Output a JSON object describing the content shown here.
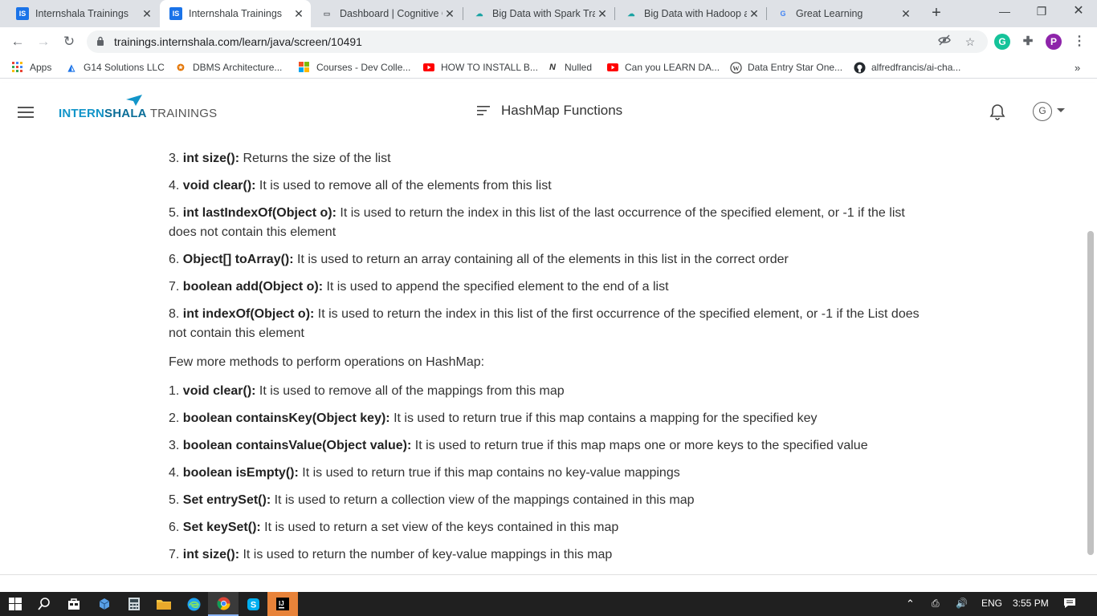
{
  "browser": {
    "tabs": [
      {
        "title": "Internshala Trainings",
        "icon": "internshala-favicon",
        "active": false
      },
      {
        "title": "Internshala Trainings",
        "icon": "internshala-favicon",
        "active": true
      },
      {
        "title": "Dashboard | Cognitive C",
        "icon": "dashboard-favicon",
        "active": false
      },
      {
        "title": "Big Data with Spark Tra",
        "icon": "cloud-favicon",
        "active": false
      },
      {
        "title": "Big Data with Hadoop a",
        "icon": "cloud-favicon",
        "active": false
      },
      {
        "title": "Great Learning",
        "icon": "google-favicon",
        "active": false
      }
    ],
    "url": "trainings.internshala.com/learn/java/screen/10491",
    "profile_initial": "P",
    "bookmarks": [
      {
        "label": "Apps",
        "icon": "apps-grid-icon"
      },
      {
        "label": "G14 Solutions LLC",
        "icon": "g14-icon"
      },
      {
        "label": "DBMS Architecture...",
        "icon": "dbms-icon"
      },
      {
        "label": "Courses - Dev Colle...",
        "icon": "windows-icon"
      },
      {
        "label": "HOW TO INSTALL B...",
        "icon": "youtube-icon"
      },
      {
        "label": "Nulled",
        "icon": "nulled-icon"
      },
      {
        "label": "Can you LEARN DA...",
        "icon": "youtube-icon"
      },
      {
        "label": "Data Entry Star One...",
        "icon": "wordpress-icon"
      },
      {
        "label": "alfredfrancis/ai-cha...",
        "icon": "github-icon"
      }
    ],
    "more_bookmarks": "»"
  },
  "header": {
    "logo_brand_part1": "INTERN",
    "logo_brand_part2": "SHALA",
    "logo_suffix": " TRAININGS",
    "page_title": "HashMap Functions",
    "user_initial": "G"
  },
  "content": {
    "list_items": [
      {
        "num": "3.",
        "sig": "int size():",
        "desc": " Returns the size of the list"
      },
      {
        "num": "4.",
        "sig": "void clear():",
        "desc": " It is used to remove all of the elements from this list"
      },
      {
        "num": "5.",
        "sig": "int lastIndexOf(Object o):",
        "desc": " It is used to return the index in this list of the last occurrence of the specified element, or -1 if the list does not contain this element"
      },
      {
        "num": "6.",
        "sig": "Object[] toArray():",
        "desc": " It is used to return an array containing all of the elements in this list in the correct order"
      },
      {
        "num": "7.",
        "sig": "boolean add(Object o):",
        "desc": " It is used to append the specified element to the end of a list"
      },
      {
        "num": "8.",
        "sig": "int indexOf(Object o):",
        "desc": " It is used to return the index in this list of the first occurrence of the specified element, or -1 if the List does not contain this element"
      }
    ],
    "intro": "Few more methods to perform operations on HashMap:",
    "map_items": [
      {
        "num": "1.",
        "sig": "void clear():",
        "desc": " It is used to remove all of the mappings from this map"
      },
      {
        "num": "2.",
        "sig": "boolean containsKey(Object key):",
        "desc": " It is used to return true if this map contains a mapping for the specified key"
      },
      {
        "num": "3.",
        "sig": "boolean containsValue(Object value):",
        "desc": " It is used to return true if this map maps one or more keys to the specified value"
      },
      {
        "num": "4.",
        "sig": "boolean isEmpty():",
        "desc": " It is used to return true if this map contains no key-value mappings"
      },
      {
        "num": "5.",
        "sig": "Set entrySet():",
        "desc": " It is used to return a collection view of the mappings contained in this map"
      },
      {
        "num": "6.",
        "sig": "Set keySet():",
        "desc": " It is used to return a set view of the keys contained in this map"
      },
      {
        "num": "7.",
        "sig": "int size():",
        "desc": " It is used to return the number of key-value mappings in this map"
      }
    ]
  },
  "taskbar": {
    "language": "ENG",
    "time": "3:55 PM"
  },
  "colors": {
    "brand_blue": "#1295c9",
    "tab_strip": "#dee1e6",
    "taskbar": "#202020",
    "grammarly": "#15c39a",
    "profile": "#8e24aa"
  }
}
